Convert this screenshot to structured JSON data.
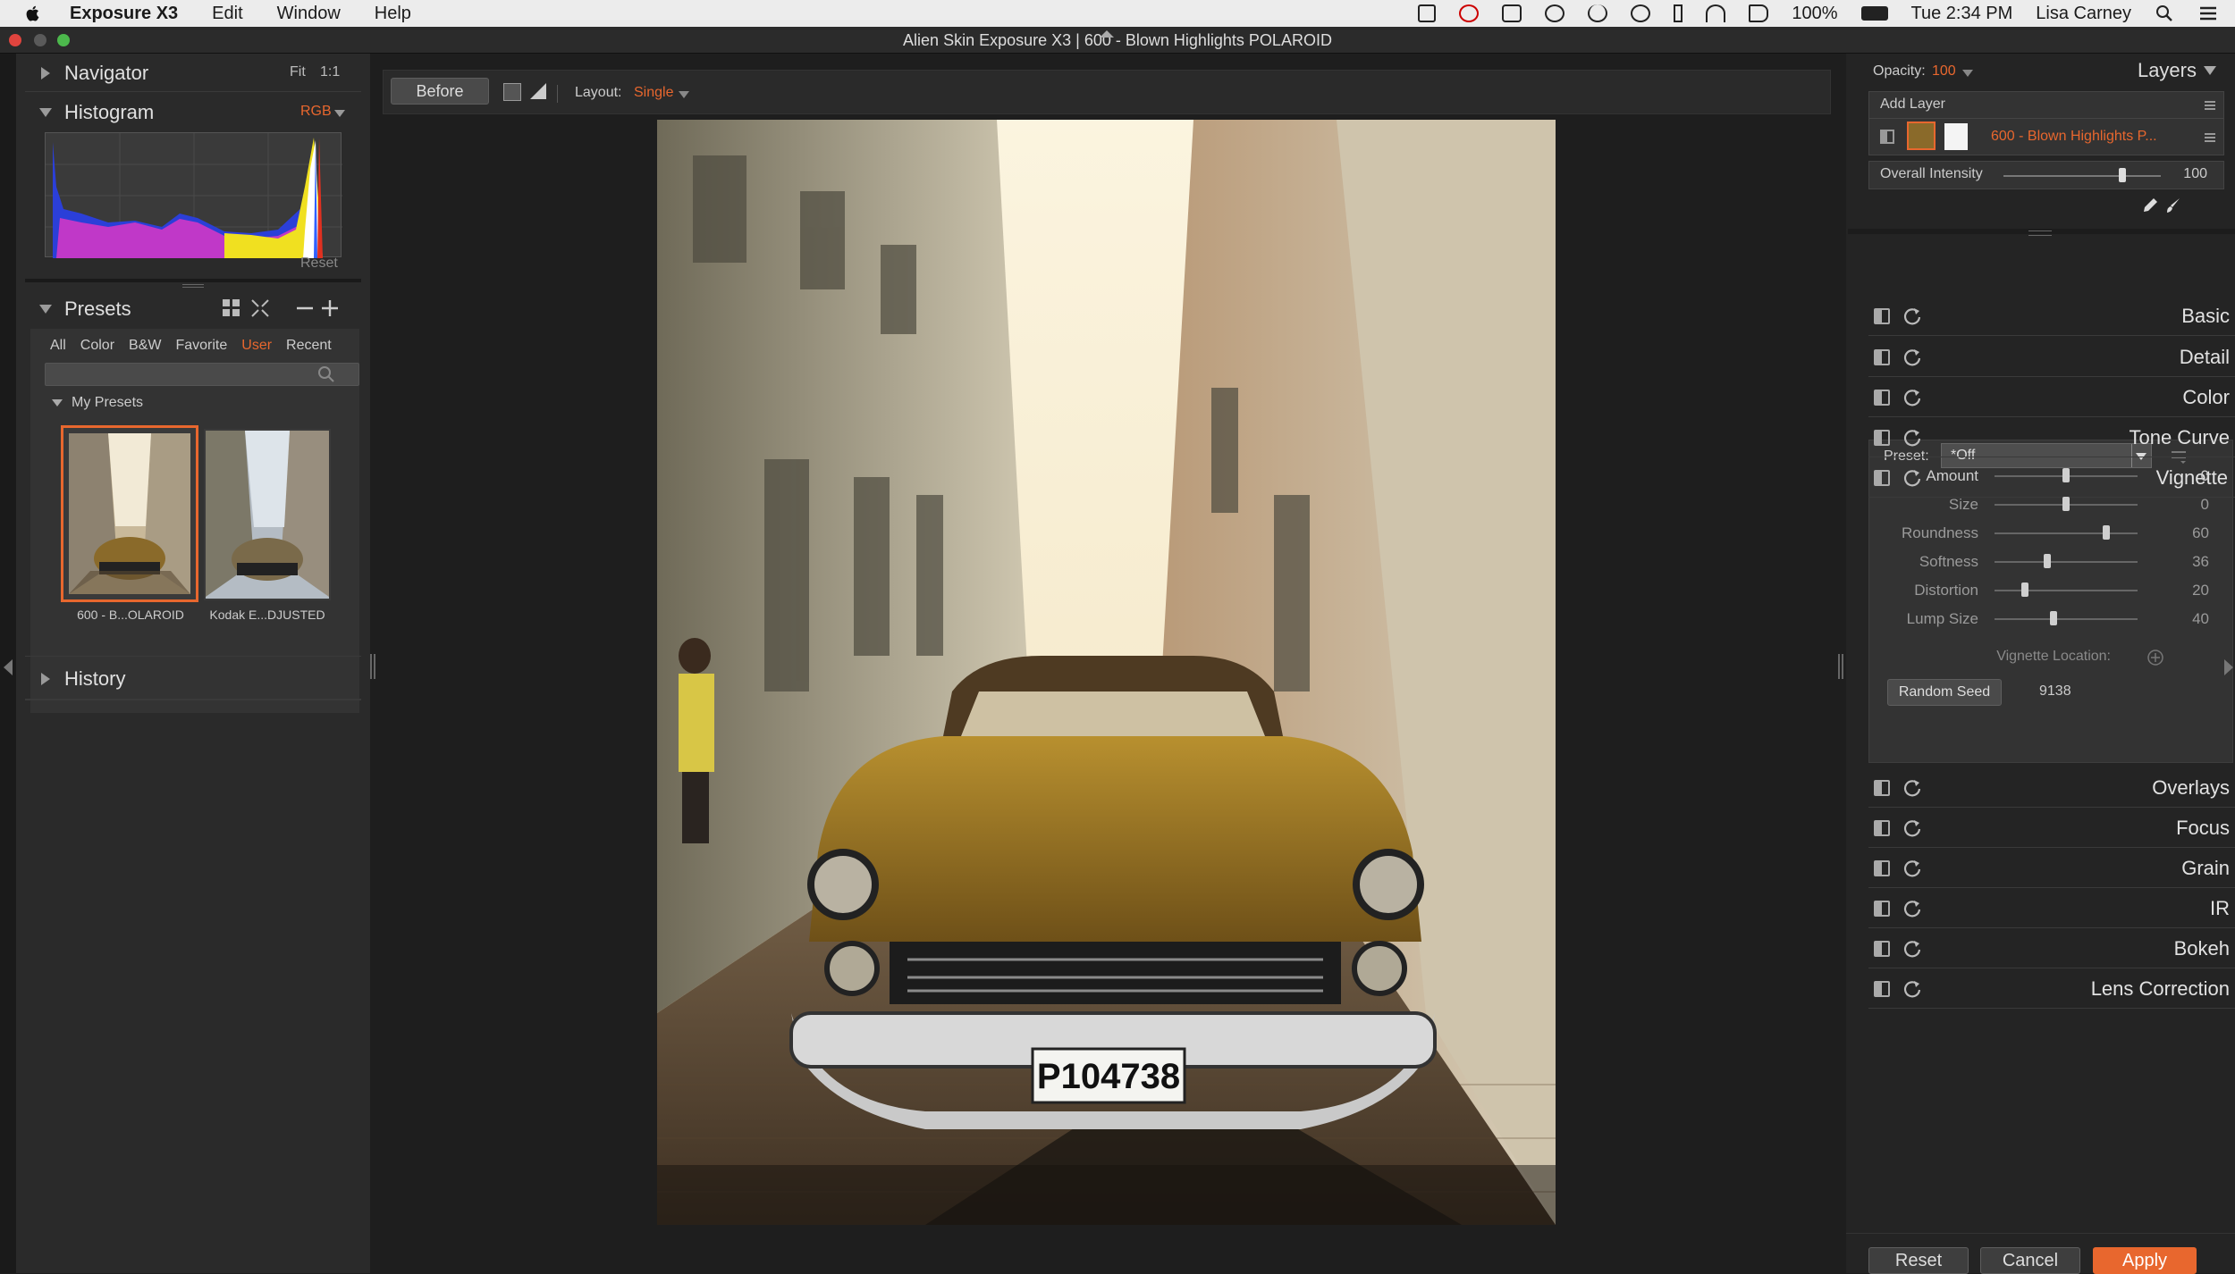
{
  "menubar": {
    "app_name": "Exposure X3",
    "items": [
      "Edit",
      "Window",
      "Help"
    ],
    "battery": "100%",
    "time": "Tue 2:34 PM",
    "user": "Lisa Carney"
  },
  "window": {
    "title": "Alien Skin Exposure X3 | 600 - Blown Highlights POLAROID"
  },
  "left": {
    "navigator": {
      "label": "Navigator",
      "fit": "Fit",
      "ratio": "1:1"
    },
    "histogram": {
      "label": "Histogram",
      "mode": "RGB",
      "reset": "Reset"
    },
    "presets": {
      "label": "Presets",
      "tabs": [
        "All",
        "Color",
        "B&W",
        "Favorite",
        "User",
        "Recent"
      ],
      "active_tab": "User",
      "search_placeholder": "",
      "group": "My Presets",
      "items": [
        {
          "caption": "600 - B...OLAROID",
          "selected": true
        },
        {
          "caption": "Kodak E...DJUSTED",
          "selected": false
        }
      ]
    },
    "history": {
      "label": "History"
    }
  },
  "toolbar": {
    "before": "Before",
    "layout_label": "Layout:",
    "layout_value": "Single"
  },
  "right": {
    "opacity_label": "Opacity:",
    "opacity_value": "100",
    "layers_label": "Layers",
    "add_layer": "Add Layer",
    "layer_name": "600 - Blown Highlights P...",
    "overall_intensity_label": "Overall Intensity",
    "overall_intensity_value": "100",
    "panels_top": [
      "Basic",
      "Detail",
      "Color",
      "Tone Curve",
      "Vignette"
    ],
    "vignette": {
      "preset_label": "Preset:",
      "preset_value": "*Off",
      "sliders": [
        {
          "label": "Amount",
          "value": "0",
          "fraction": 0.5
        },
        {
          "label": "Size",
          "value": "0",
          "fraction": 0.5
        },
        {
          "label": "Roundness",
          "value": "60",
          "fraction": 0.78
        },
        {
          "label": "Softness",
          "value": "36",
          "fraction": 0.37
        },
        {
          "label": "Distortion",
          "value": "20",
          "fraction": 0.21
        },
        {
          "label": "Lump Size",
          "value": "40",
          "fraction": 0.41
        }
      ],
      "location_label": "Vignette Location:",
      "random_seed_label": "Random Seed",
      "random_seed_value": "9138"
    },
    "panels_bottom": [
      "Overlays",
      "Focus",
      "Grain",
      "IR",
      "Bokeh",
      "Lens Correction"
    ],
    "buttons": {
      "reset": "Reset",
      "cancel": "Cancel",
      "apply": "Apply"
    }
  },
  "photo": {
    "plate": "P104738"
  },
  "colors": {
    "accent": "#e8672e",
    "panel": "#2a2a2a",
    "background": "#1e1e1e"
  }
}
